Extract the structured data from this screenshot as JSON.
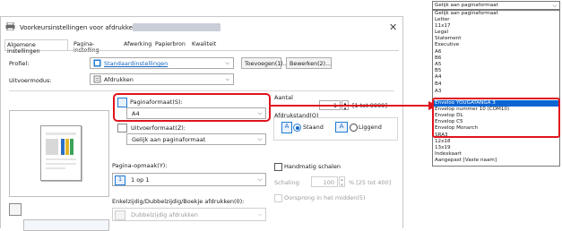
{
  "dialog": {
    "title": "Voorkeursinstellingen voor afdrukken voor",
    "close_glyph": "✕"
  },
  "tabs": [
    {
      "label": "Algemene instellingen"
    },
    {
      "label": "Pagina-instelling"
    },
    {
      "label": "Afwerking"
    },
    {
      "label": "Papierbron"
    },
    {
      "label": "Kwaliteit"
    }
  ],
  "profile": {
    "label": "Profiel:",
    "value": "Standaardinstellingen",
    "add_button": "Toevoegen(1)...",
    "edit_button": "Bewerken(2)..."
  },
  "output_mode": {
    "label": "Uitvoermodus:",
    "value": "Afdrukken"
  },
  "page_size": {
    "label": "Paginaformaat(S):",
    "value": "A4"
  },
  "copies": {
    "label": "Aantal",
    "value": "1",
    "range": "[1 tot 9999]"
  },
  "output_size": {
    "label": "Uitvoerformaat(Z):",
    "value": "Gelijk aan paginaformaat"
  },
  "orientation": {
    "label": "Afdrukstand(O)",
    "portrait": "Staand",
    "landscape": "Liggend",
    "portrait_icon": "A",
    "landscape_icon": "A"
  },
  "page_layout": {
    "label": "Pagina-opmaak(Y):",
    "value": "1 op 1",
    "value_icon": "1"
  },
  "manual_scale": {
    "label": "Handmatig schalen",
    "scale_label": "Schaling:",
    "value": "100",
    "range": "% [25 tot 400]",
    "origin_label": "Oorsprong in het midden(5)"
  },
  "duplex": {
    "label": "Enkelzijdig/Dubbelzijdig/Boekje afdrukken(0):",
    "value": "Dubbelzijdig afdrukken"
  },
  "dropdown": {
    "header": "Gelijk aan paginaformaat",
    "items": [
      "Gelijk aan paginaformaat",
      "Letter",
      "11x17",
      "Legal",
      "Statement",
      "Executive",
      "A6",
      "B6",
      "A5",
      "B5",
      "A4",
      "B4",
      "A3",
      "Enveloo YOUGATANGA 3",
      "Envelop nummer 10 (COM10)",
      "Envelop DL",
      "Envelop C5",
      "Envelop Monarch",
      "SRA3",
      "12x18",
      "13x19",
      "Indexkaart",
      "Aangepast [Vaste naam]"
    ],
    "selected_index": 13
  },
  "colors": {
    "highlight": "#e0141e",
    "selection": "#0a64d2",
    "accent": "#1565c0"
  }
}
